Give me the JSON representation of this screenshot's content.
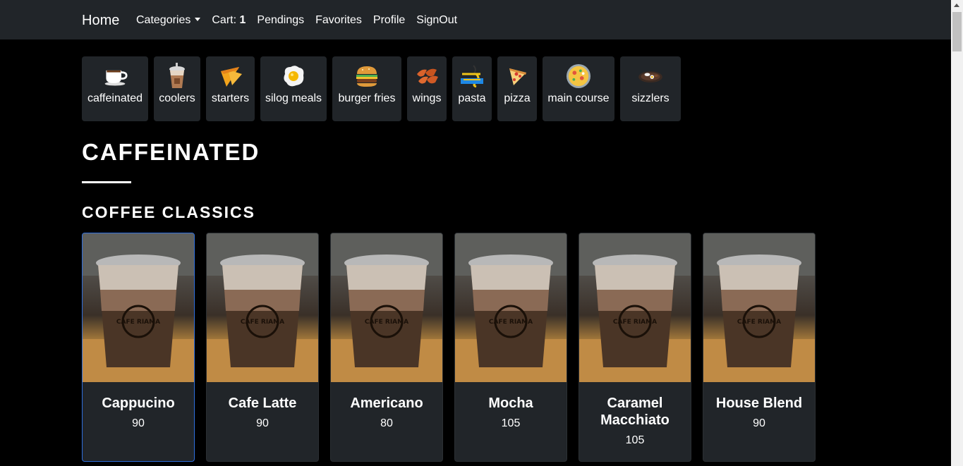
{
  "navbar": {
    "brand": "Home",
    "categories_label": "Categories",
    "cart_label": "Cart:",
    "cart_count": "1",
    "pendings_label": "Pendings",
    "favorites_label": "Favorites",
    "profile_label": "Profile",
    "signout_label": "SignOut"
  },
  "categories": [
    {
      "label": "caffeinated",
      "icon": "coffee-cup-icon"
    },
    {
      "label": "coolers",
      "icon": "iced-drink-icon"
    },
    {
      "label": "starters",
      "icon": "nachos-icon"
    },
    {
      "label": "silog meals",
      "icon": "fried-egg-icon"
    },
    {
      "label": "burger fries",
      "icon": "burger-icon"
    },
    {
      "label": "wings",
      "icon": "chicken-wings-icon"
    },
    {
      "label": "pasta",
      "icon": "pasta-icon"
    },
    {
      "label": "pizza",
      "icon": "pizza-slice-icon"
    },
    {
      "label": "main course",
      "icon": "paella-icon"
    },
    {
      "label": "sizzlers",
      "icon": "sizzling-plate-icon"
    }
  ],
  "section": {
    "title": "CAFFEINATED",
    "subtitle": "COFFEE CLASSICS"
  },
  "products": [
    {
      "name": "Cappucino",
      "price": "90"
    },
    {
      "name": "Cafe Latte",
      "price": "90"
    },
    {
      "name": "Americano",
      "price": "80"
    },
    {
      "name": "Mocha",
      "price": "105"
    },
    {
      "name": "Caramel Macchiato",
      "price": "105"
    },
    {
      "name": "House Blend",
      "price": "90"
    }
  ],
  "product_image_text": "CAFE RIAMA",
  "colors": {
    "navbar_bg": "#212529",
    "page_bg": "#000000",
    "card_bg": "#212529",
    "active_border": "#2f6fde"
  }
}
